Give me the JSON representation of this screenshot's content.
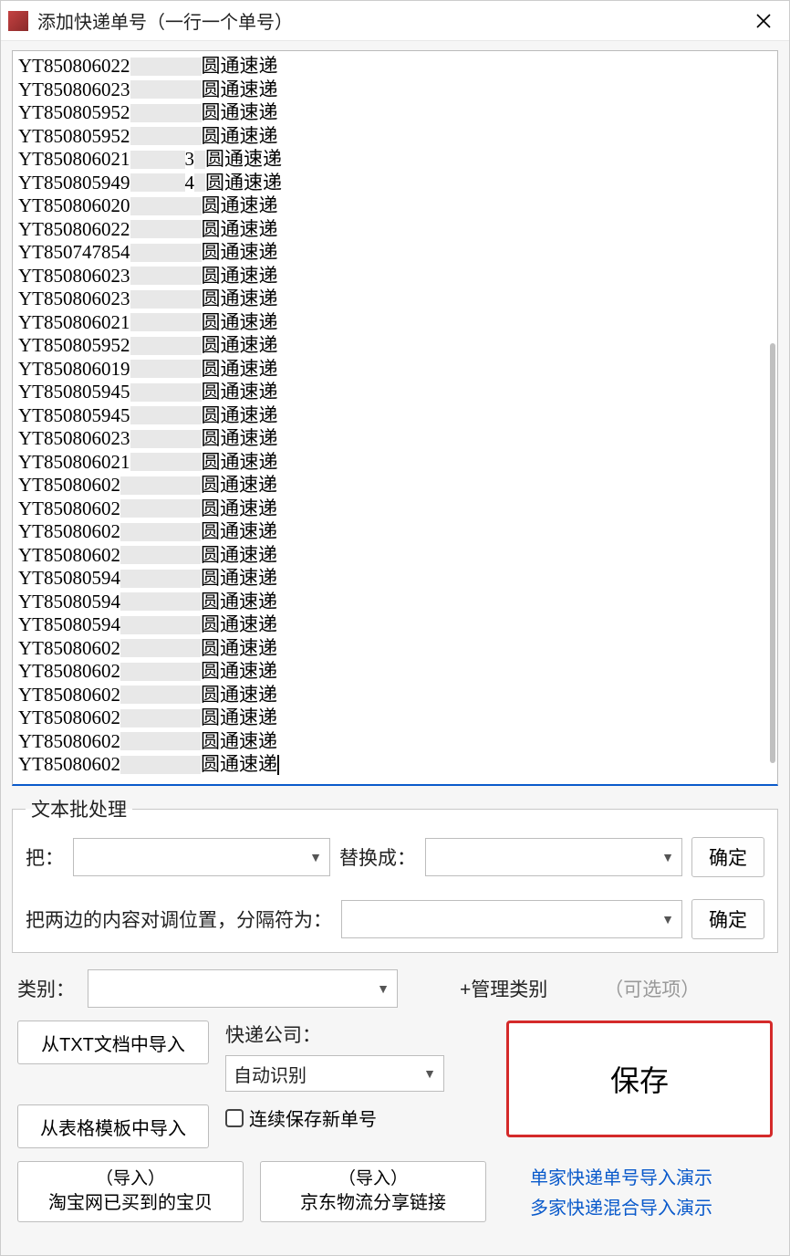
{
  "window": {
    "title": "添加快递单号（一行一个单号）"
  },
  "tracking_rows": [
    {
      "prefix": "YT850806022",
      "mid_w": 78,
      "carrier": "圆通速递"
    },
    {
      "prefix": "YT850806023",
      "mid_w": 78,
      "carrier": "圆通速递"
    },
    {
      "prefix": "YT850805952",
      "mid_w": 78,
      "carrier": "圆通速递"
    },
    {
      "prefix": "YT850805952",
      "mid_w": 78,
      "carrier": "圆通速递"
    },
    {
      "prefix": "YT850806021",
      "mid_w": 60,
      "mid_tail": "3",
      "carrier": "圆通速递"
    },
    {
      "prefix": "YT850805949",
      "mid_w": 60,
      "mid_tail": "4",
      "carrier": "圆通速递"
    },
    {
      "prefix": "YT850806020",
      "mid_w": 78,
      "carrier": "圆通速递"
    },
    {
      "prefix": "YT850806022",
      "mid_w": 78,
      "carrier": "圆通速递"
    },
    {
      "prefix": "YT850747854",
      "mid_w": 78,
      "carrier": "圆通速递"
    },
    {
      "prefix": "YT850806023",
      "mid_w": 78,
      "carrier": "圆通速递"
    },
    {
      "prefix": "YT850806023",
      "mid_w": 78,
      "carrier": "圆通速递"
    },
    {
      "prefix": "YT850806021",
      "mid_w": 78,
      "carrier": "圆通速递"
    },
    {
      "prefix": "YT850805952",
      "mid_w": 78,
      "carrier": "圆通速递"
    },
    {
      "prefix": "YT850806019",
      "mid_w": 78,
      "carrier": "圆通速递"
    },
    {
      "prefix": "YT850805945",
      "mid_w": 78,
      "carrier": "圆通速递"
    },
    {
      "prefix": "YT850805945",
      "mid_w": 78,
      "carrier": "圆通速递"
    },
    {
      "prefix": "YT850806023",
      "mid_w": 78,
      "carrier": "圆通速递"
    },
    {
      "prefix": "YT850806021",
      "mid_w": 78,
      "carrier": "圆通速递"
    },
    {
      "prefix": "YT85080602",
      "mid_w": 88,
      "carrier": "圆通速递"
    },
    {
      "prefix": "YT85080602",
      "mid_w": 88,
      "carrier": "圆通速递"
    },
    {
      "prefix": "YT85080602",
      "mid_w": 88,
      "carrier": "圆通速递"
    },
    {
      "prefix": "YT85080602",
      "mid_w": 88,
      "carrier": "圆通速递"
    },
    {
      "prefix": "YT85080594",
      "mid_w": 88,
      "carrier": "圆通速递"
    },
    {
      "prefix": "YT85080594",
      "mid_w": 88,
      "carrier": "圆通速递"
    },
    {
      "prefix": "YT85080594",
      "mid_w": 88,
      "carrier": "圆通速递"
    },
    {
      "prefix": "YT85080602",
      "mid_w": 88,
      "carrier": "圆通速递"
    },
    {
      "prefix": "YT85080602",
      "mid_w": 88,
      "carrier": "圆通速递"
    },
    {
      "prefix": "YT85080602",
      "mid_w": 88,
      "carrier": "圆通速递"
    },
    {
      "prefix": "YT85080602",
      "mid_w": 88,
      "carrier": "圆通速递"
    },
    {
      "prefix": "YT85080602",
      "mid_w": 88,
      "carrier": "圆通速递"
    },
    {
      "prefix": "YT85080602",
      "mid_w": 88,
      "carrier": "圆通速递",
      "caret": true
    }
  ],
  "batch": {
    "legend": "文本批处理",
    "replace_from_label": "把：",
    "replace_to_label": "替换成：",
    "confirm_label": "确定",
    "swap_label": "把两边的内容对调位置，分隔符为：",
    "confirm_label2": "确定"
  },
  "category": {
    "label": "类别：",
    "manage_label": "+管理类别",
    "optional_hint": "（可选项）"
  },
  "import": {
    "from_txt": "从TXT文档中导入",
    "from_template": "从表格模板中导入"
  },
  "courier": {
    "label": "快递公司：",
    "selected": "自动识别",
    "continuous_save": "连续保存新单号"
  },
  "save_label": "保存",
  "bottom_imports": {
    "taobao_top": "（导入）",
    "taobao_bottom": "淘宝网已买到的宝贝",
    "jd_top": "（导入）",
    "jd_bottom": "京东物流分享链接"
  },
  "demos": {
    "single": "单家快递单号导入演示",
    "multi": "多家快递混合导入演示"
  }
}
